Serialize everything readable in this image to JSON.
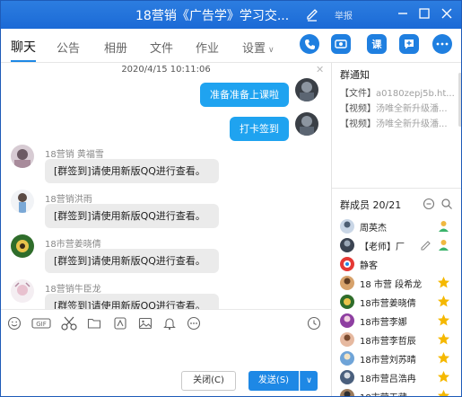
{
  "window": {
    "title": "18营销《广告学》学习交...",
    "report": "举报"
  },
  "tabs": [
    {
      "label": "聊天",
      "active": true
    },
    {
      "label": "公告"
    },
    {
      "label": "相册"
    },
    {
      "label": "文件"
    },
    {
      "label": "作业"
    },
    {
      "label": "设置"
    }
  ],
  "tab_actions": [
    "phone-icon",
    "video-icon",
    "course-icon",
    "add-app-icon",
    "more-icon"
  ],
  "tab_action_glyphs": {
    "course": "课"
  },
  "chat": {
    "timestamp": "2020/4/15 10:11:06",
    "my_messages": [
      {
        "text": "准备准备上课啦"
      },
      {
        "text": "打卡签到"
      }
    ],
    "messages": [
      {
        "sender": "18营销 黄福雪",
        "text": "[群签到]请使用新版QQ进行查看。"
      },
      {
        "sender": "18营销洪雨",
        "text": "[群签到]请使用新版QQ进行查看。"
      },
      {
        "sender": "18市营姜晓倩",
        "text": "[群签到]请使用新版QQ进行查看。"
      },
      {
        "sender": "18营销牛臣龙",
        "text": "[群签到]请使用新版QQ进行查看。"
      }
    ]
  },
  "toolbar_icons": [
    "emoji-icon",
    "gif-icon",
    "scissors-icon",
    "folder-icon",
    "graffiti-icon",
    "image-icon",
    "bell-icon",
    "more-dots-icon",
    "history-icon"
  ],
  "buttons": {
    "close": "关闭(C)",
    "send": "发送(S)"
  },
  "notice": {
    "title": "群通知",
    "items": [
      {
        "tag": "【文件】",
        "text": "a0180zepj5b.ht..."
      },
      {
        "tag": "【视频】",
        "text": "汤唯全新升级潘..."
      },
      {
        "tag": "【视频】",
        "text": "汤唯全新升级潘..."
      }
    ]
  },
  "members": {
    "title": "群成员 20/21",
    "list": [
      {
        "name": "周英杰",
        "badge": "member"
      },
      {
        "name": "【老师】厂",
        "badge": "member"
      },
      {
        "name": "静客",
        "badge": ""
      },
      {
        "name": "18 市营 段希龙",
        "badge": "star"
      },
      {
        "name": "18市营姜晓倩",
        "badge": "star"
      },
      {
        "name": "18市营李娜",
        "badge": "star"
      },
      {
        "name": "18市营李哲辰",
        "badge": "star"
      },
      {
        "name": "18市营刘苏晴",
        "badge": "star"
      },
      {
        "name": "18市营吕浩冉",
        "badge": "star"
      },
      {
        "name": "18市营王藏",
        "badge": "star"
      }
    ]
  },
  "colors": {
    "title_bar": "#1b6ad6",
    "accent": "#1e88e5",
    "my_bubble": "#1fa3f0",
    "other_bubble": "#ebebeb",
    "star": "#f5b800"
  }
}
